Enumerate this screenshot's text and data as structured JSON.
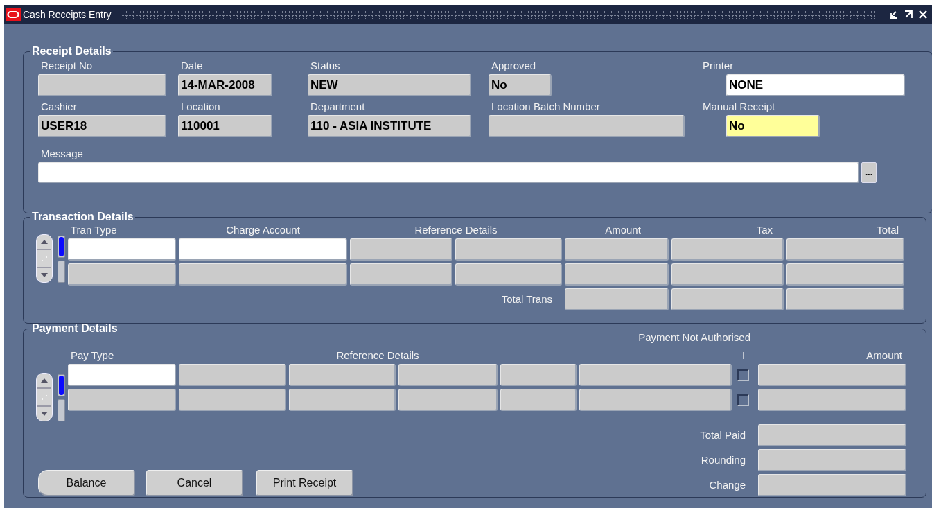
{
  "window": {
    "title": "Cash Receipts Entry"
  },
  "receipt_details": {
    "title": "Receipt Details",
    "fields": [
      {
        "label": "Receipt No",
        "kind": "display"
      },
      {
        "label": "Date",
        "value": "14-MAR-2008",
        "kind": "display"
      },
      {
        "label": "Status",
        "value": "NEW",
        "kind": "display"
      },
      {
        "label": "Approved",
        "value": "No",
        "kind": "display"
      },
      {
        "label": "Printer",
        "value": "NONE",
        "kind": "input"
      },
      {
        "label": "Cashier",
        "value": "USER18",
        "kind": "display"
      },
      {
        "label": "Location",
        "value": "110001",
        "kind": "display"
      },
      {
        "label": "Department",
        "value": "110 - ASIA INSTITUTE",
        "kind": "display"
      },
      {
        "label": "Location Batch Number",
        "kind": "display"
      },
      {
        "label": "Manual Receipt",
        "value": "No",
        "kind": "required"
      }
    ],
    "message": {
      "label": "Message",
      "lov_button": "..."
    }
  },
  "transaction_details": {
    "title": "Transaction Details",
    "columns": [
      "Tran Type",
      "Charge Account",
      "Reference Details",
      "Amount",
      "Tax",
      "Total"
    ],
    "rows": [
      {
        "selected": true,
        "cells": [
          {
            "kind": "input"
          },
          {
            "kind": "input"
          },
          {
            "kind": "display"
          },
          {
            "kind": "display"
          },
          {
            "kind": "display"
          },
          {
            "kind": "display"
          },
          {
            "kind": "display"
          }
        ]
      },
      {
        "selected": false,
        "cells": [
          {
            "kind": "display"
          },
          {
            "kind": "display"
          },
          {
            "kind": "display"
          },
          {
            "kind": "display"
          },
          {
            "kind": "display"
          },
          {
            "kind": "display"
          },
          {
            "kind": "display"
          }
        ]
      }
    ],
    "total_label": "Total Trans"
  },
  "payment_details": {
    "title": "Payment Details",
    "group_header": "Payment Not Authorised",
    "columns": [
      "Pay Type",
      "Reference Details",
      "I",
      "Amount"
    ],
    "rows": [
      {
        "selected": true,
        "not_authorised": false,
        "cells": [
          {
            "kind": "input"
          },
          {
            "kind": "display"
          },
          {
            "kind": "display"
          },
          {
            "kind": "display"
          },
          {
            "kind": "display"
          },
          {
            "kind": "display"
          },
          {
            "kind": "display"
          }
        ]
      },
      {
        "selected": false,
        "not_authorised": false,
        "cells": [
          {
            "kind": "display"
          },
          {
            "kind": "display"
          },
          {
            "kind": "display"
          },
          {
            "kind": "display"
          },
          {
            "kind": "display"
          },
          {
            "kind": "display"
          },
          {
            "kind": "display"
          }
        ]
      }
    ],
    "totals": [
      "Total Paid",
      "Rounding",
      "Change"
    ]
  },
  "buttons": [
    "Balance",
    "Cancel",
    "Print Receipt"
  ]
}
